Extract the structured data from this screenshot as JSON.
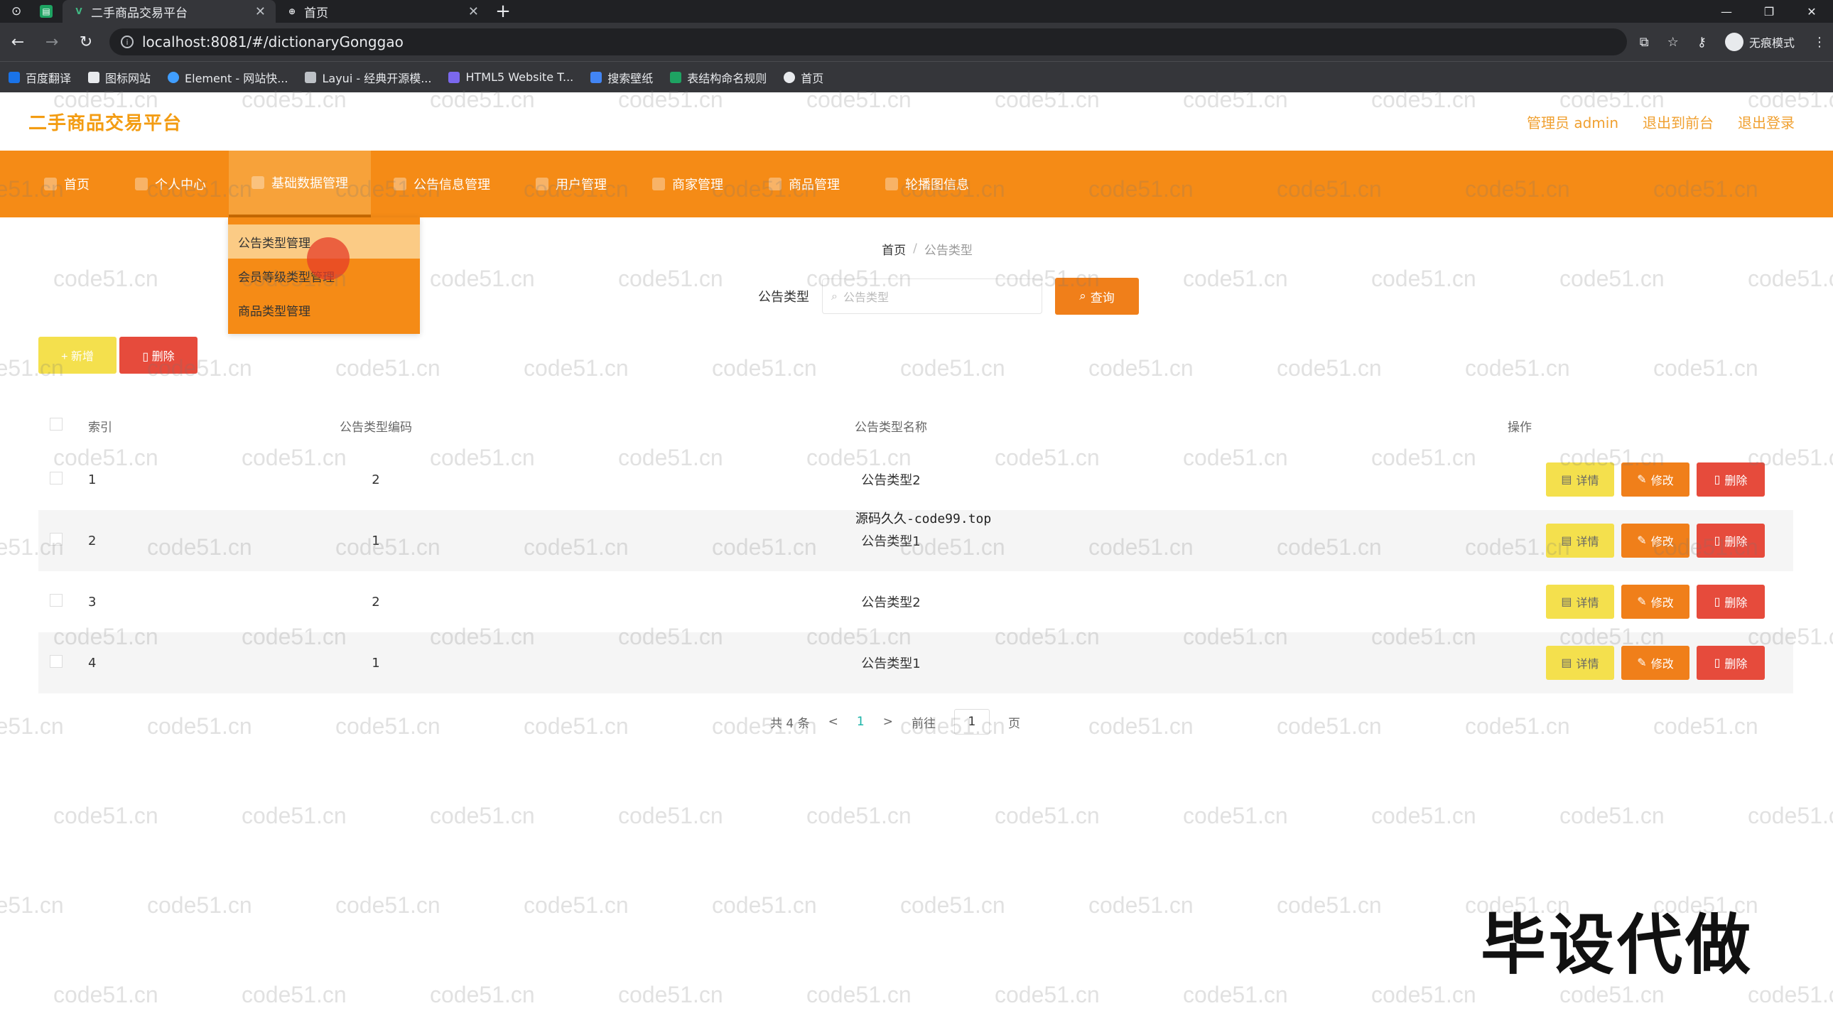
{
  "browser": {
    "tabs": [
      {
        "title": "二手商品交易平台",
        "active": true
      },
      {
        "title": "首页",
        "active": false
      }
    ],
    "url": "localhost:8081/#/dictionaryGonggao",
    "incognito_label": "无痕模式",
    "bookmarks": [
      "百度翻译",
      "图标网站",
      "Element - 网站快...",
      "Layui - 经典开源模...",
      "HTML5 Website T...",
      "搜索壁纸",
      "表结构命名规则",
      "首页"
    ]
  },
  "app": {
    "title": "二手商品交易平台",
    "header_links": [
      "管理员 admin",
      "退出到前台",
      "退出登录"
    ]
  },
  "nav": {
    "items": [
      "首页",
      "个人中心",
      "基础数据管理",
      "公告信息管理",
      "用户管理",
      "商家管理",
      "商品管理",
      "轮播图信息"
    ],
    "active_index": 2
  },
  "dropdown": {
    "items": [
      "公告类型管理",
      "会员等级类型管理",
      "商品类型管理"
    ]
  },
  "breadcrumb": {
    "home": "首页",
    "sep": "/",
    "current": "公告类型"
  },
  "search": {
    "label": "公告类型",
    "placeholder": "公告类型",
    "query_label": "查询"
  },
  "actions": {
    "add_label": "+ 新增",
    "delete_label": "删除"
  },
  "table": {
    "headers": [
      "索引",
      "公告类型编码",
      "公告类型名称",
      "操作"
    ],
    "rows": [
      {
        "index": "1",
        "code": "2",
        "name": "公告类型2"
      },
      {
        "index": "2",
        "code": "1",
        "name": "公告类型1"
      },
      {
        "index": "3",
        "code": "2",
        "name": "公告类型2"
      },
      {
        "index": "4",
        "code": "1",
        "name": "公告类型1"
      }
    ],
    "row_actions": {
      "detail": "详情",
      "edit": "修改",
      "remove": "删除"
    }
  },
  "pager": {
    "total": "共 4 条",
    "prev": "<",
    "current_page": "1",
    "next": ">",
    "goto": "前往",
    "goto_value": "1",
    "page_unit": "页"
  },
  "overlay": {
    "center_text": "源码久久-code99.top",
    "big_text": "毕设代做",
    "watermark": "code51.cn"
  },
  "colors": {
    "accent": "#f58b16",
    "title": "#f39c12",
    "danger": "#e64b3c",
    "warning": "#f4e04d"
  }
}
